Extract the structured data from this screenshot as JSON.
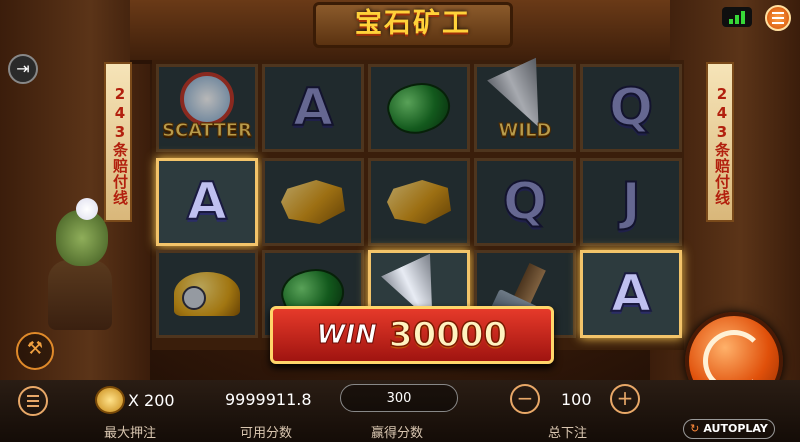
{
  "title": "宝石矿工",
  "side_banner_text": "243条赔付线",
  "reels": [
    [
      {
        "symbol": "scatter",
        "label": "SCATTER",
        "highlight": false
      },
      {
        "symbol": "A",
        "label": "A",
        "highlight": true
      },
      {
        "symbol": "helmet",
        "label": "",
        "highlight": false
      }
    ],
    [
      {
        "symbol": "A",
        "label": "A",
        "highlight": false
      },
      {
        "symbol": "gold",
        "label": "",
        "highlight": false
      },
      {
        "symbol": "emerald",
        "label": "",
        "highlight": false
      }
    ],
    [
      {
        "symbol": "emerald",
        "label": "",
        "highlight": false
      },
      {
        "symbol": "gold",
        "label": "",
        "highlight": false
      },
      {
        "symbol": "drill",
        "label": "",
        "highlight": true
      }
    ],
    [
      {
        "symbol": "wild",
        "label": "WILD",
        "highlight": false
      },
      {
        "symbol": "Q",
        "label": "Q",
        "highlight": false
      },
      {
        "symbol": "hammer",
        "label": "",
        "highlight": false
      }
    ],
    [
      {
        "symbol": "Q",
        "label": "Q",
        "highlight": false
      },
      {
        "symbol": "J",
        "label": "J",
        "highlight": false
      },
      {
        "symbol": "A",
        "label": "A",
        "highlight": true
      }
    ]
  ],
  "win": {
    "label": "WIN",
    "amount": "30000"
  },
  "bottom": {
    "max_bet_multiplier": "X 200",
    "max_bet_label": "最大押注",
    "balance": "9999911.8",
    "balance_label": "可用分数",
    "win_value": "300",
    "win_label": "赢得分数",
    "total_bet": "100",
    "total_bet_label": "总下注",
    "autoplay_label": "AUTOPLAY"
  },
  "colors": {
    "accent": "#e8a868",
    "win_red": "#d42a1c",
    "gold": "#ffd23a"
  },
  "icons": [
    "menu-icon",
    "exit-icon",
    "signal-icon",
    "settings-menu-icon",
    "coin-stack-icon",
    "minus-icon",
    "plus-icon",
    "spin-icon",
    "autoplay-icon",
    "tools-icon"
  ]
}
